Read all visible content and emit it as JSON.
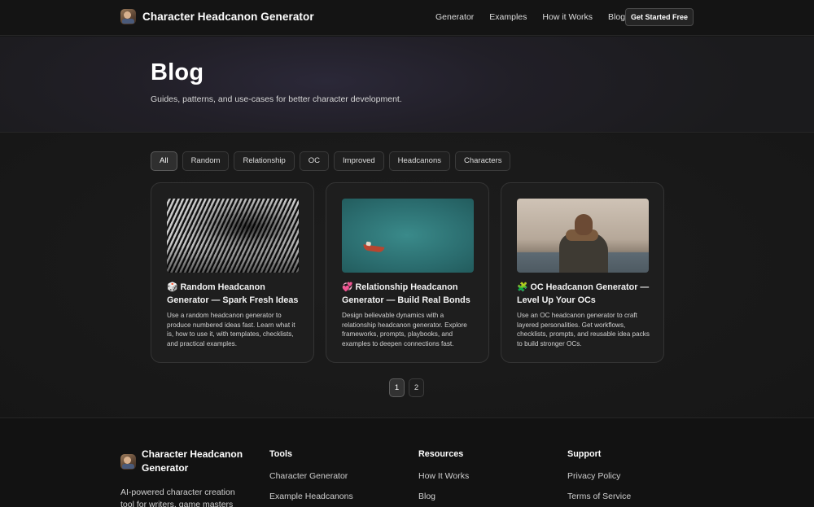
{
  "header": {
    "brand": "Character Headcanon Generator",
    "nav": [
      "Generator",
      "Examples",
      "How it Works",
      "Blog"
    ],
    "cta": "Get Started Free"
  },
  "hero": {
    "title": "Blog",
    "subtitle": "Guides, patterns, and use-cases for better character development."
  },
  "filters": [
    "All",
    "Random",
    "Relationship",
    "OC",
    "Improved",
    "Headcanons",
    "Characters"
  ],
  "active_filter": "All",
  "posts": [
    {
      "title": "🎲 Random Headcanon Generator — Spark Fresh Ideas",
      "description": "Use a random headcanon generator to produce numbered ideas fast. Learn what it is, how to use it, with templates, checklists, and practical examples.",
      "image": "architecture-curves"
    },
    {
      "title": "💞 Relationship Headcanon Generator — Build Real Bonds",
      "description": "Design believable dynamics with a relationship headcanon generator. Explore frameworks, prompts, playbooks, and examples to deepen connections fast.",
      "image": "boat-on-sea"
    },
    {
      "title": "🧩 OC Headcanon Generator — Level Up Your OCs",
      "description": "Use an OC headcanon generator to craft layered personalities. Get workflows, checklists, prompts, and reusable idea packs to build stronger OCs.",
      "image": "person-by-sea"
    }
  ],
  "pagination": {
    "pages": [
      "1",
      "2"
    ],
    "current": "1"
  },
  "footer": {
    "brand": "Character Headcanon Generator",
    "tagline": "AI-powered character creation tool for writers, game masters",
    "columns": [
      {
        "heading": "Tools",
        "links": [
          "Character Generator",
          "Example Headcanons"
        ]
      },
      {
        "heading": "Resources",
        "links": [
          "How It Works",
          "Blog"
        ]
      },
      {
        "heading": "Support",
        "links": [
          "Privacy Policy",
          "Terms of Service"
        ]
      }
    ]
  }
}
